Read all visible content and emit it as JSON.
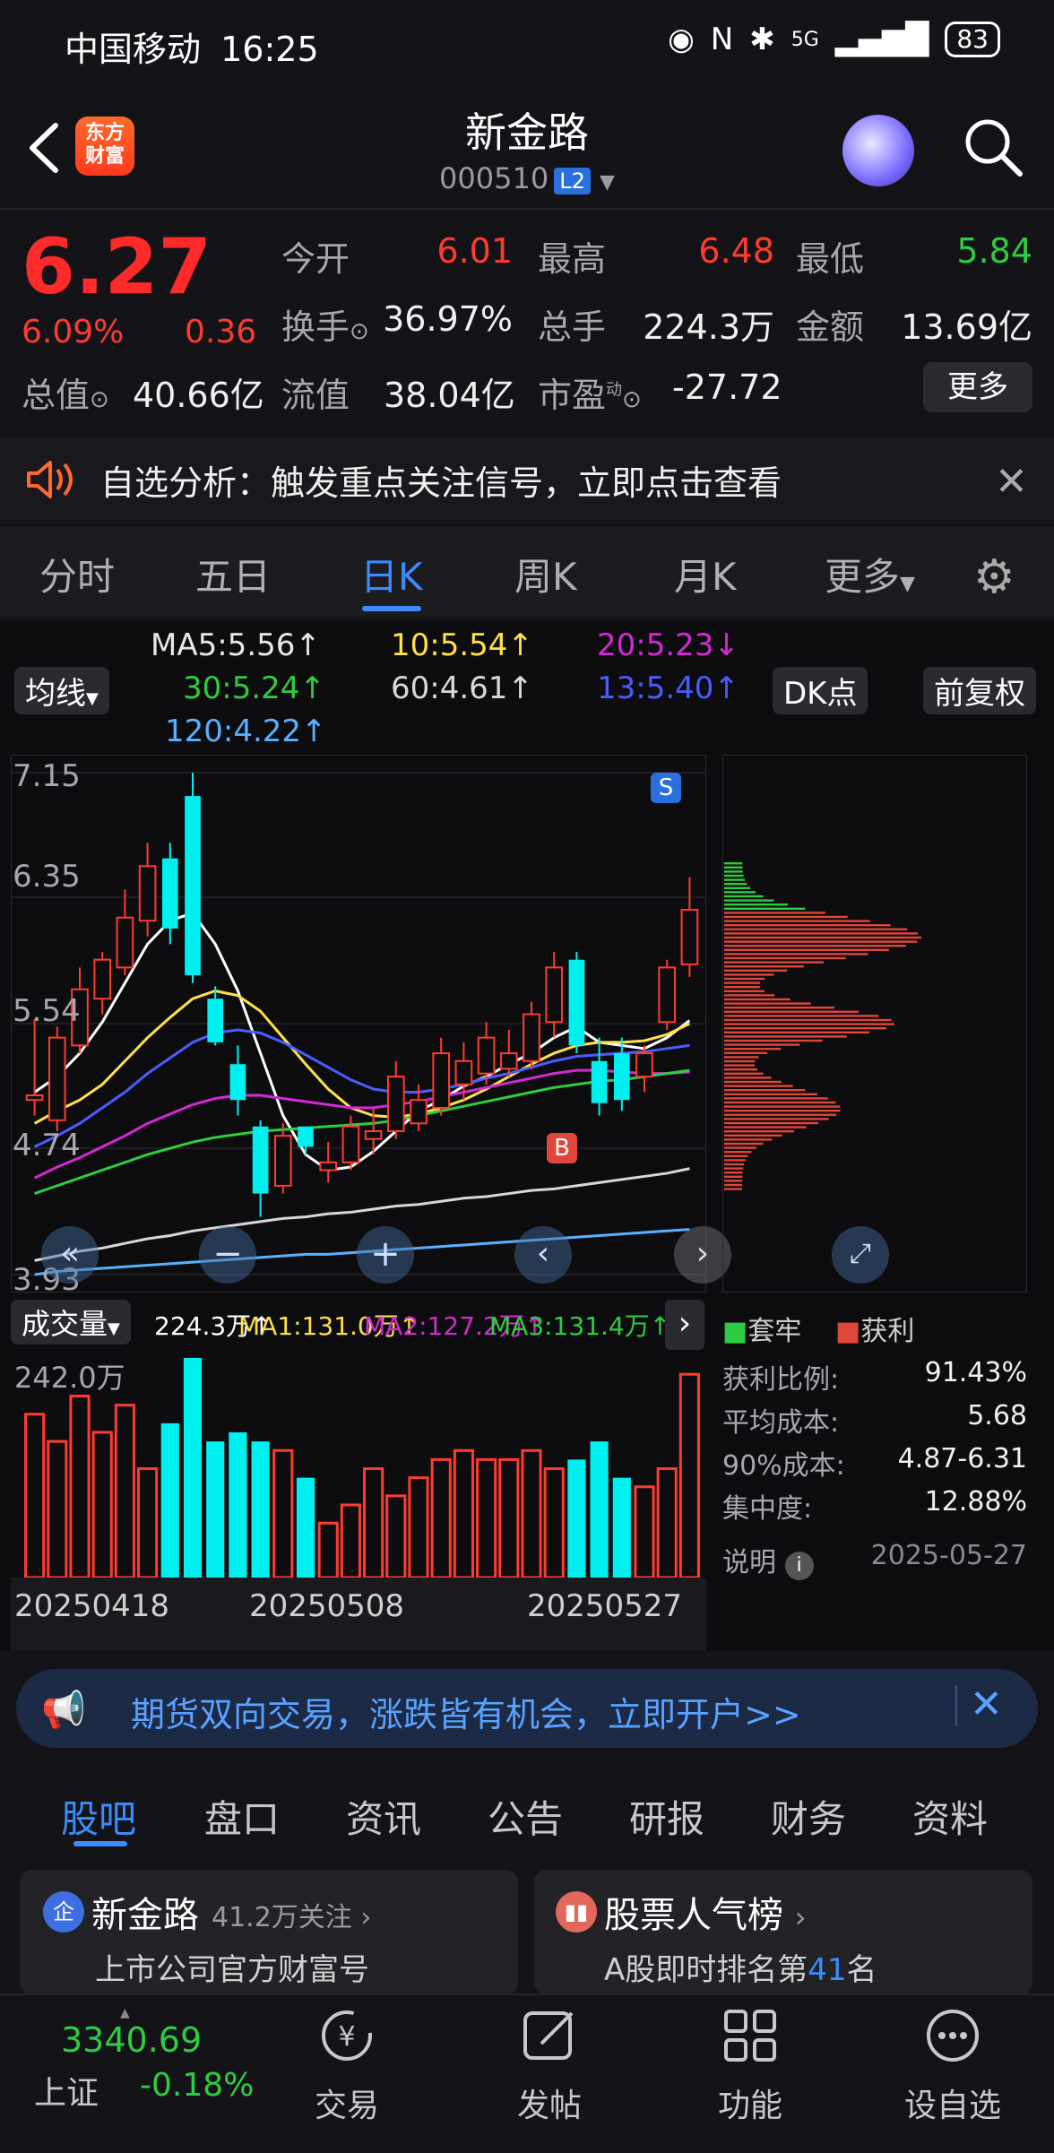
{
  "status": {
    "carrier": "中国移动",
    "time": "16:25",
    "battery": "83",
    "network": "5G"
  },
  "header": {
    "name": "新金路",
    "code": "000510",
    "level_badge": "L2",
    "logo_text_top": "东方",
    "logo_text_bottom": "财富"
  },
  "quote": {
    "price": "6.27",
    "pct": "6.09%",
    "change": "0.36",
    "rows": [
      [
        {
          "label": "今开",
          "value": "6.01",
          "color": "#ff3b30"
        },
        {
          "label": "最高",
          "value": "6.48",
          "color": "#ff3b30"
        },
        {
          "label": "最低",
          "value": "5.84",
          "color": "#2ecc40"
        }
      ],
      [
        {
          "label": "换手",
          "value": "36.97%",
          "color": "#f0f0f0"
        },
        {
          "label": "总手",
          "value": "224.3万",
          "color": "#f0f0f0"
        },
        {
          "label": "金额",
          "value": "13.69亿",
          "color": "#f0f0f0"
        }
      ],
      [
        {
          "label": "总值",
          "value": "40.66亿",
          "color": "#f0f0f0"
        },
        {
          "label": "流值",
          "value": "38.04亿",
          "color": "#f0f0f0"
        },
        {
          "label": "市盈",
          "value": "-27.72",
          "color": "#f0f0f0"
        }
      ]
    ],
    "pe_superscript": "动",
    "more": "更多"
  },
  "notice": {
    "text": "自选分析：触发重点关注信号，立即点击查看"
  },
  "tabs": [
    "分时",
    "五日",
    "日K",
    "周K",
    "月K",
    "更多"
  ],
  "ma_legend": {
    "ma_button": "均线",
    "lines": [
      {
        "text": "MA5:5.56↑",
        "color": "#ffffff"
      },
      {
        "text": "10:5.54↑",
        "color": "#ffe04a"
      },
      {
        "text": "20:5.23↓",
        "color": "#d22ad2"
      },
      {
        "text": "30:5.24↑",
        "color": "#2ecc40"
      },
      {
        "text": "60:4.61↑",
        "color": "#d8d8d8"
      },
      {
        "text": "13:5.40↑",
        "color": "#4a5cff"
      },
      {
        "text": "120:4.22↑",
        "color": "#5ab0ff"
      }
    ],
    "dk_button": "DK点",
    "adjust_button": "前复权"
  },
  "chart_data": {
    "type": "candlestick",
    "y_ticks": [
      "7.15",
      "6.35",
      "5.54",
      "4.74",
      "3.93"
    ],
    "ylim": [
      3.93,
      7.15
    ],
    "candles": [
      [
        5.05,
        5.57,
        4.95,
        5.08
      ],
      [
        4.92,
        5.52,
        4.85,
        5.45
      ],
      [
        5.4,
        5.9,
        5.35,
        5.76
      ],
      [
        5.7,
        6.0,
        5.6,
        5.95
      ],
      [
        5.9,
        6.4,
        5.85,
        6.22
      ],
      [
        6.2,
        6.7,
        6.1,
        6.55
      ],
      [
        6.6,
        6.7,
        6.05,
        6.15
      ],
      [
        7.0,
        7.15,
        5.8,
        5.85
      ],
      [
        5.7,
        5.78,
        5.4,
        5.42
      ],
      [
        5.28,
        5.4,
        4.95,
        5.05
      ],
      [
        4.88,
        4.92,
        4.3,
        4.45
      ],
      [
        4.5,
        4.9,
        4.45,
        4.82
      ],
      [
        4.88,
        4.88,
        4.7,
        4.75
      ],
      [
        4.6,
        4.78,
        4.52,
        4.65
      ],
      [
        4.65,
        4.95,
        4.6,
        4.88
      ],
      [
        4.8,
        5.0,
        4.7,
        4.85
      ],
      [
        4.85,
        5.3,
        4.8,
        5.2
      ],
      [
        4.9,
        5.15,
        4.85,
        5.05
      ],
      [
        5.0,
        5.45,
        4.95,
        5.35
      ],
      [
        5.15,
        5.42,
        5.05,
        5.3
      ],
      [
        5.22,
        5.55,
        5.15,
        5.45
      ],
      [
        5.25,
        5.5,
        5.2,
        5.35
      ],
      [
        5.3,
        5.68,
        5.25,
        5.6
      ],
      [
        5.55,
        6.0,
        5.45,
        5.9
      ],
      [
        5.95,
        6.0,
        5.35,
        5.4
      ],
      [
        5.3,
        5.45,
        4.95,
        5.03
      ],
      [
        5.35,
        5.45,
        4.98,
        5.05
      ],
      [
        5.2,
        5.4,
        5.1,
        5.35
      ],
      [
        5.55,
        5.95,
        5.5,
        5.9
      ],
      [
        5.92,
        6.48,
        5.84,
        6.27
      ]
    ],
    "ma_lines": [
      {
        "name": "MA5",
        "color": "#ffffff",
        "values": [
          5.1,
          5.2,
          5.35,
          5.55,
          5.8,
          6.05,
          6.2,
          6.25,
          6.05,
          5.75,
          5.35,
          4.95,
          4.7,
          4.6,
          4.62,
          4.72,
          4.85,
          4.98,
          5.05,
          5.14,
          5.2,
          5.28,
          5.35,
          5.45,
          5.52,
          5.42,
          5.4,
          5.38,
          5.45,
          5.56
        ]
      },
      {
        "name": "MA10",
        "color": "#ffe04a",
        "values": [
          4.9,
          4.98,
          5.05,
          5.15,
          5.3,
          5.45,
          5.58,
          5.7,
          5.75,
          5.72,
          5.62,
          5.45,
          5.28,
          5.12,
          5.0,
          4.95,
          4.94,
          4.96,
          5.0,
          5.05,
          5.12,
          5.2,
          5.28,
          5.35,
          5.4,
          5.42,
          5.42,
          5.43,
          5.47,
          5.54
        ]
      },
      {
        "name": "MA13",
        "color": "#4a5cff",
        "values": [
          4.75,
          4.82,
          4.9,
          5.0,
          5.1,
          5.22,
          5.32,
          5.42,
          5.48,
          5.5,
          5.48,
          5.42,
          5.34,
          5.26,
          5.18,
          5.12,
          5.1,
          5.1,
          5.12,
          5.15,
          5.19,
          5.22,
          5.26,
          5.3,
          5.33,
          5.34,
          5.35,
          5.36,
          5.38,
          5.4
        ]
      },
      {
        "name": "MA20",
        "color": "#d22ad2",
        "values": [
          4.55,
          4.62,
          4.68,
          4.75,
          4.82,
          4.9,
          4.96,
          5.02,
          5.06,
          5.08,
          5.08,
          5.06,
          5.04,
          5.02,
          5.0,
          5.0,
          5.02,
          5.04,
          5.07,
          5.1,
          5.13,
          5.16,
          5.19,
          5.22,
          5.24,
          5.24,
          5.23,
          5.22,
          5.22,
          5.23
        ]
      },
      {
        "name": "MA30",
        "color": "#2ecc40",
        "values": [
          4.45,
          4.5,
          4.55,
          4.6,
          4.65,
          4.7,
          4.74,
          4.78,
          4.81,
          4.83,
          4.85,
          4.86,
          4.87,
          4.88,
          4.89,
          4.9,
          4.92,
          4.95,
          4.98,
          5.01,
          5.04,
          5.07,
          5.1,
          5.13,
          5.15,
          5.17,
          5.18,
          5.2,
          5.22,
          5.24
        ]
      },
      {
        "name": "MA60",
        "color": "#d8d8d8",
        "values": [
          4.02,
          4.05,
          4.08,
          4.1,
          4.13,
          4.16,
          4.18,
          4.21,
          4.23,
          4.25,
          4.27,
          4.29,
          4.3,
          4.32,
          4.33,
          4.35,
          4.37,
          4.38,
          4.4,
          4.42,
          4.43,
          4.45,
          4.47,
          4.48,
          4.5,
          4.52,
          4.54,
          4.56,
          4.58,
          4.61
        ]
      },
      {
        "name": "MA120",
        "color": "#5ab0ff",
        "values": [
          3.93,
          3.95,
          3.96,
          3.97,
          3.98,
          3.99,
          4.0,
          4.01,
          4.02,
          4.03,
          4.04,
          4.05,
          4.06,
          4.06,
          4.07,
          4.08,
          4.09,
          4.1,
          4.11,
          4.12,
          4.13,
          4.14,
          4.15,
          4.16,
          4.17,
          4.18,
          4.19,
          4.2,
          4.21,
          4.22
        ]
      }
    ],
    "volume_label": "成交量",
    "volume_legend": [
      {
        "text": "224.3万↑",
        "color": "#ffffff"
      },
      {
        "text": "MA1:131.0万↑",
        "color": "#ffe04a"
      },
      {
        "text": "MA2:127.2万↑",
        "color": "#d22ad2"
      },
      {
        "text": "MA3:131.4万↑",
        "color": "#2ecc40"
      }
    ],
    "volume_max_label": "242.0万",
    "volumes": [
      180,
      150,
      200,
      160,
      190,
      120,
      170,
      242,
      150,
      160,
      150,
      140,
      110,
      60,
      80,
      120,
      90,
      110,
      130,
      140,
      130,
      130,
      140,
      120,
      130,
      150,
      110,
      100,
      120,
      224
    ],
    "x_dates": [
      "20250418",
      "20250508",
      "20250527"
    ]
  },
  "chip": {
    "legend_trapped": "套牢",
    "legend_profit": "获利",
    "rows": [
      {
        "label": "获利比例:",
        "value": "91.43%"
      },
      {
        "label": "平均成本:",
        "value": "5.68"
      },
      {
        "label": "90%成本:",
        "value": "4.87-6.31"
      },
      {
        "label": "集中度:",
        "value": "12.88%"
      }
    ],
    "note": "说明",
    "date": "2025-05-27"
  },
  "promo": {
    "text": "期货双向交易，涨跌皆有机会，立即开户>>"
  },
  "sub_tabs": [
    "股吧",
    "盘口",
    "资讯",
    "公告",
    "研报",
    "财务",
    "资料"
  ],
  "cards": [
    {
      "badge": "企",
      "title": "新金路",
      "meta": "41.2万关注",
      "sub": "上市公司官方财富号"
    },
    {
      "title": "股票人气榜",
      "sub_prefix": "A股即时排名第",
      "rank": "41",
      "sub_suffix": "名"
    }
  ],
  "bottom_nav": {
    "index_value": "3340.69",
    "index_name": "上证",
    "index_change": "-0.18%",
    "items": [
      "交易",
      "发帖",
      "功能",
      "设自选"
    ]
  }
}
